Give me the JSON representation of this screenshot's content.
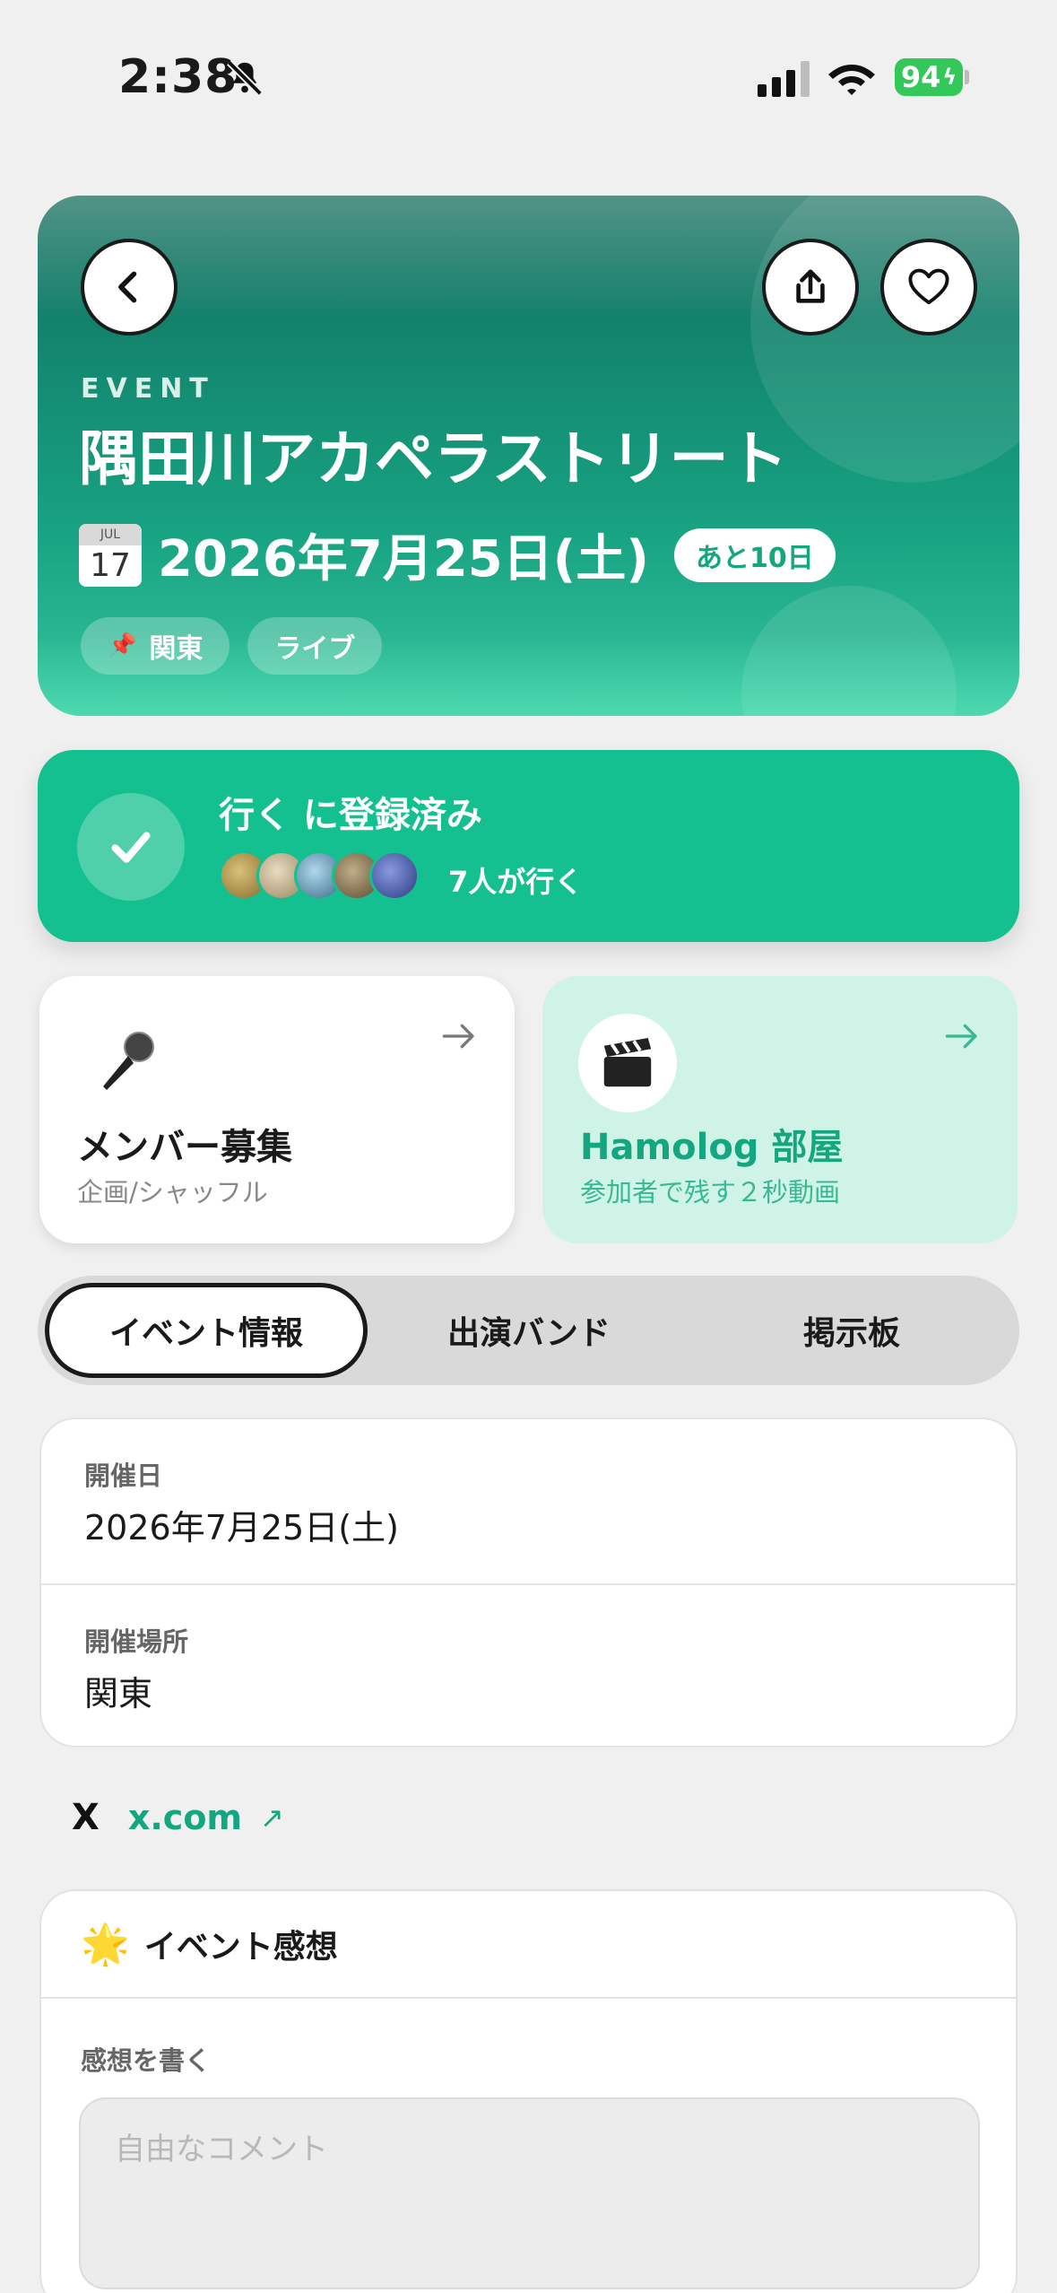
{
  "status_bar": {
    "time": "2:38",
    "battery": "94"
  },
  "hero": {
    "label": "EVENT",
    "title": "隅田川アカペラストリート",
    "calendar_month": "JUL",
    "calendar_day": "17",
    "date": "2026年7月25日(土)",
    "countdown": "あと10日",
    "tags": [
      "関東",
      "ライブ"
    ]
  },
  "going": {
    "title": "行く に登録済み",
    "count_text": "7人が行く",
    "avatar_colors": [
      "#b89a4a",
      "#c8b48a",
      "#6aa0c0",
      "#8a7a5a",
      "#4a5aa0"
    ]
  },
  "cards": {
    "member": {
      "title": "メンバー募集",
      "subtitle": "企画/シャッフル",
      "icon": "microphone-icon"
    },
    "hamolog": {
      "title": "Hamolog 部屋",
      "subtitle": "参加者で残す２秒動画",
      "icon": "clapper-board-icon"
    }
  },
  "tabs": [
    "イベント情報",
    "出演バンド",
    "掲示板"
  ],
  "info": {
    "date_label": "開催日",
    "date_value": "2026年7月25日(土)",
    "place_label": "開催場所",
    "place_value": "関東"
  },
  "link": {
    "icon": "X",
    "text": "x.com"
  },
  "impressions": {
    "title": "イベント感想",
    "write_label": "感想を書く",
    "placeholder": "自由なコメント"
  },
  "colors": {
    "accent": "#14c08f",
    "accent_text": "#14a67f",
    "hero_dark": "#0f6a5a",
    "card_mint": "#cff3e6"
  }
}
